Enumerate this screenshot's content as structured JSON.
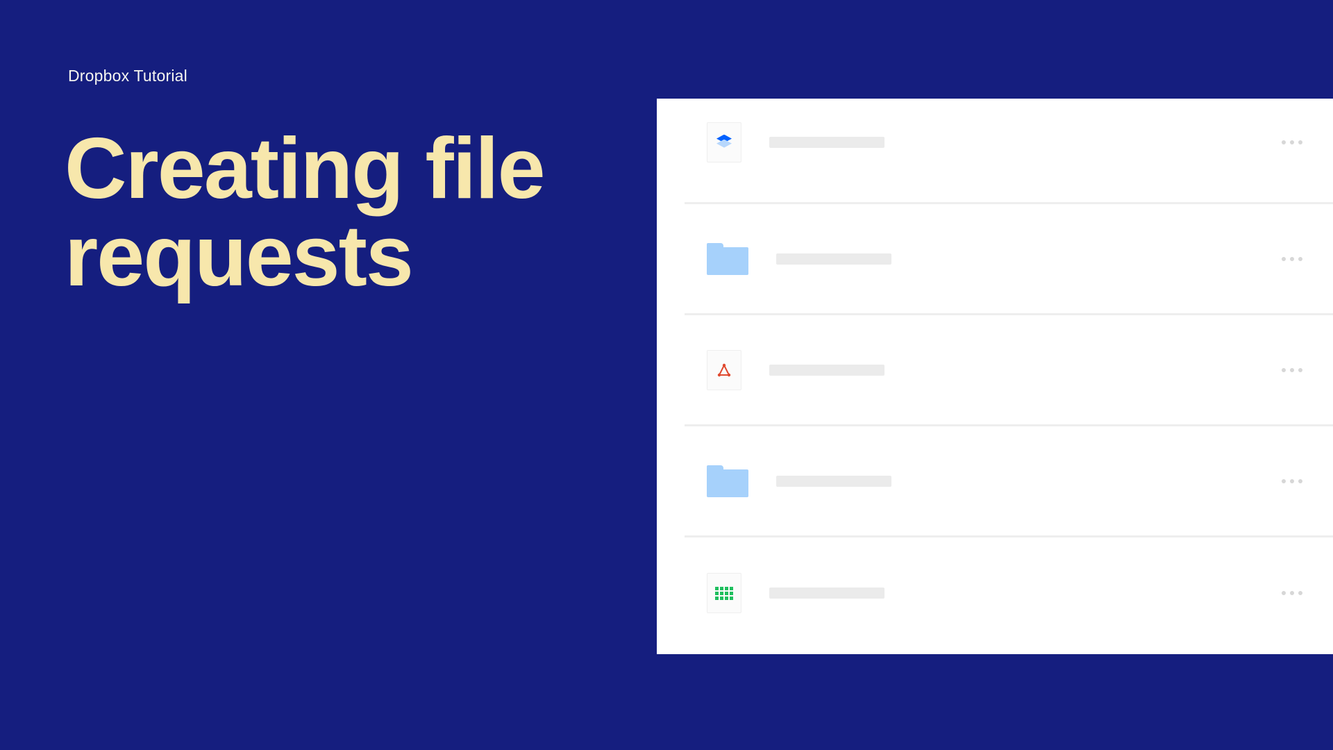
{
  "eyebrow": "Dropbox Tutorial",
  "headline_line1": "Creating file",
  "headline_line2": "requests",
  "colors": {
    "background": "#151e7f",
    "headline": "#f7e7ac",
    "eyebrow": "#f5f5f0",
    "panel": "#ffffff",
    "placeholder": "#ebebeb",
    "divider": "#eeeeee",
    "folder": "#a6d1fb",
    "dropbox_blue": "#0061ff",
    "pdf_red": "#e0492f",
    "sheet_green": "#1fbf5f"
  },
  "rows": [
    {
      "icon": "dropbox-file-icon"
    },
    {
      "icon": "folder-icon"
    },
    {
      "icon": "pdf-icon"
    },
    {
      "icon": "folder-icon"
    },
    {
      "icon": "spreadsheet-icon"
    }
  ]
}
